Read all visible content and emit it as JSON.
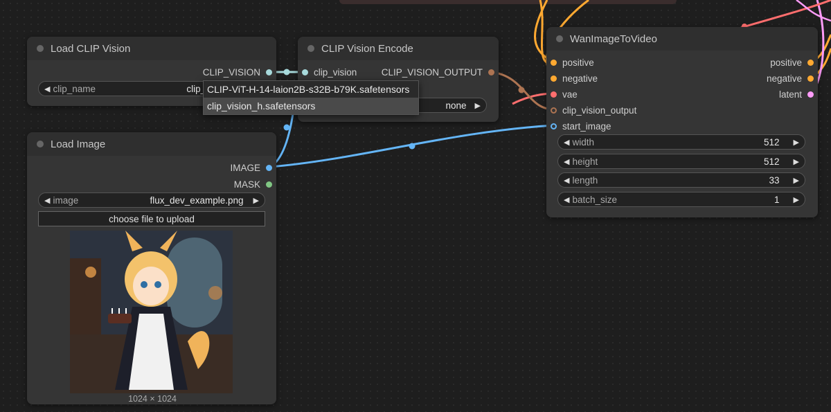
{
  "nodes": {
    "load_clip_vision": {
      "title": "Load CLIP Vision",
      "output": "CLIP_VISION",
      "widget": {
        "label": "clip_name",
        "value": "clip_vision_h.safe"
      }
    },
    "clip_vision_encode": {
      "title": "CLIP Vision Encode",
      "input": "clip_vision",
      "output": "CLIP_VISION_OUTPUT",
      "widget": {
        "value": "none"
      }
    },
    "load_image": {
      "title": "Load Image",
      "outputs": [
        "IMAGE",
        "MASK"
      ],
      "widget": {
        "label": "image",
        "value": "flux_dev_example.png"
      },
      "upload_label": "choose file to upload",
      "dimensions": "1024 × 1024"
    },
    "wan_image_to_video": {
      "title": "WanImageToVideo",
      "inputs": [
        "positive",
        "negative",
        "vae",
        "clip_vision_output",
        "start_image"
      ],
      "outputs": [
        "positive",
        "negative",
        "latent"
      ],
      "widgets": [
        {
          "label": "width",
          "value": "512"
        },
        {
          "label": "height",
          "value": "512"
        },
        {
          "label": "length",
          "value": "33"
        },
        {
          "label": "batch_size",
          "value": "1"
        }
      ]
    }
  },
  "dropdown": {
    "options": [
      "CLIP-ViT-H-14-laion2B-s32B-b79K.safetensors",
      "clip_vision_h.safetensors"
    ],
    "selected_index": 1
  },
  "colors": {
    "clip_vision": "#a8dadc",
    "clip_vision_output": "#ad7452",
    "image": "#64b5f6",
    "mask": "#81c784",
    "conditioning": "#ffa931",
    "vae": "#ff6e6e",
    "latent": "#ff9cf9"
  }
}
